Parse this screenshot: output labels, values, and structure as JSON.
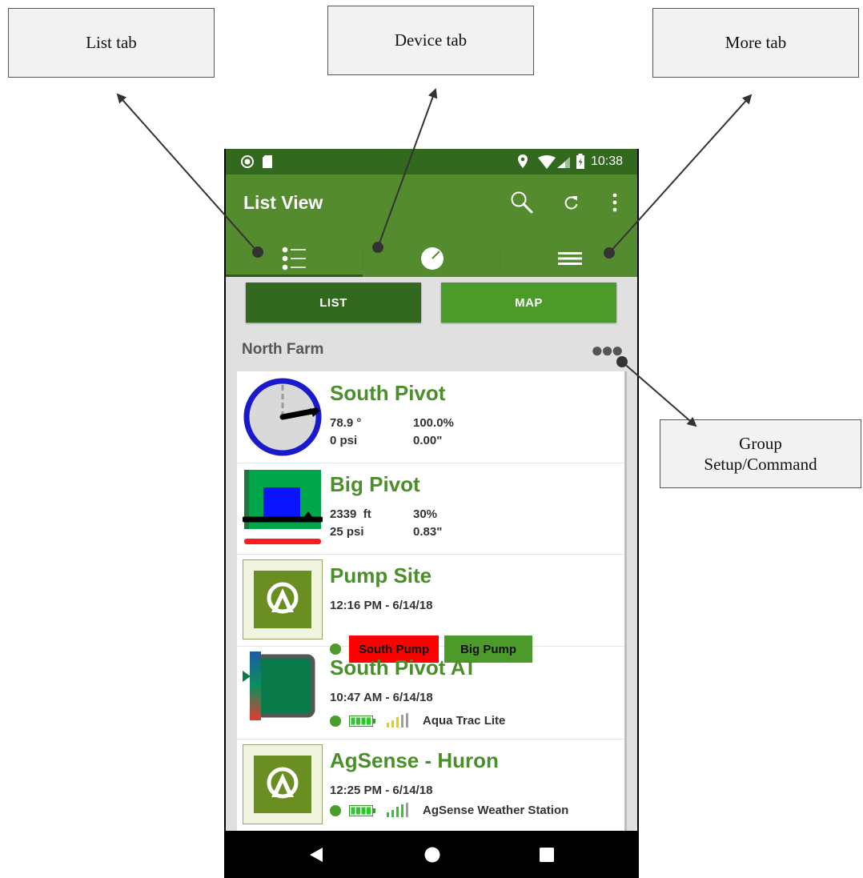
{
  "callouts": {
    "list_tab": "List tab",
    "device_tab": "Device tab",
    "more_tab": "More tab",
    "group_setup_line1": "Group",
    "group_setup_line2": "Setup/Command"
  },
  "status_bar": {
    "time": "10:38"
  },
  "app_bar": {
    "title": "List View"
  },
  "toggle": {
    "list_label": "LIST",
    "map_label": "MAP",
    "selected": "LIST"
  },
  "group": {
    "name": "North Farm"
  },
  "devices": [
    {
      "name": "South Pivot",
      "v1": "78.9 °",
      "v2": "100.0%",
      "v3": "0 psi",
      "v4": "0.00\""
    },
    {
      "name": "Big Pivot",
      "v1": "2339  ft",
      "v2": "30%",
      "v3": "25 psi",
      "v4": "0.83\""
    },
    {
      "name": "Pump Site",
      "time": "12:16 PM - 6/14/18",
      "pump1": "South Pump",
      "pump2": "Big Pump"
    },
    {
      "name": "South Pivot AT",
      "time": "10:47 AM - 6/14/18",
      "type": "Aqua Trac Lite"
    },
    {
      "name": "AgSense - Huron",
      "time": "12:25 PM - 6/14/18",
      "type": "AgSense Weather Station"
    }
  ],
  "colors": {
    "status_bar": "#33691e",
    "app_bar": "#558b2f",
    "list_active": "#33691e",
    "map_button": "#4c9a2a",
    "device_name": "#4a8f2a",
    "south_pump": "#ff0000",
    "big_pump": "#4c9a2a",
    "pivot_ring": "#1a1acc"
  }
}
